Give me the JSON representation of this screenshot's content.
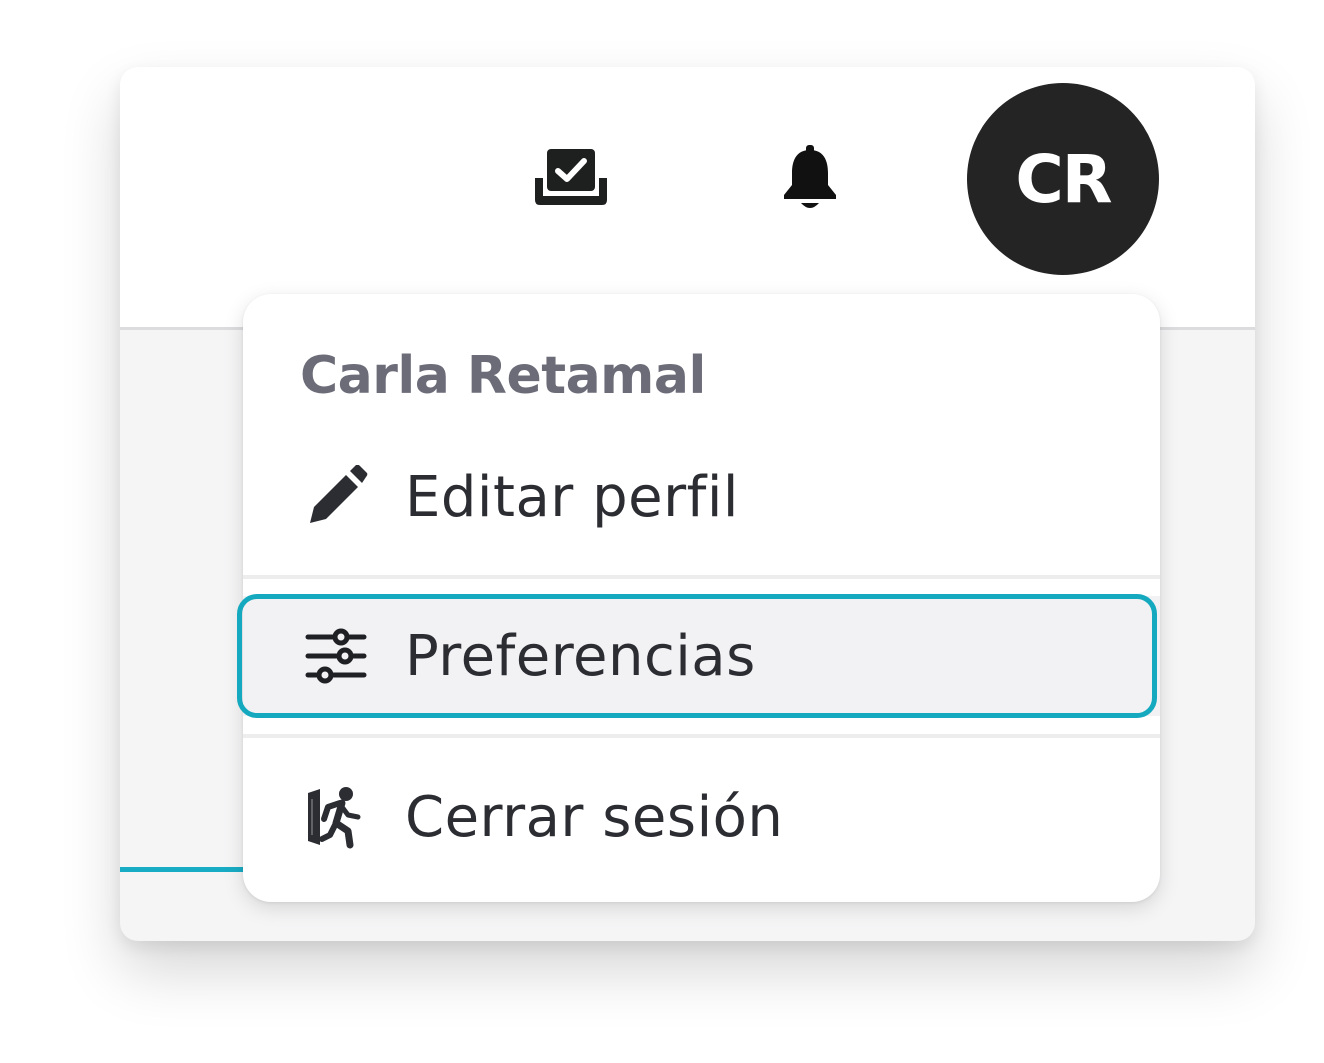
{
  "header": {
    "tasks_icon": "tasks-check-tray-icon",
    "notifications_icon": "bell-icon",
    "avatar_initials": "CR",
    "avatar_color": "#232423"
  },
  "user_menu": {
    "user_name": "Carla Retamal",
    "items": [
      {
        "label": "Editar perfil",
        "icon": "pencil-icon"
      },
      {
        "label": "Preferencias",
        "icon": "sliders-icon",
        "focused": true
      },
      {
        "label": "Cerrar sesión",
        "icon": "logout-runner-icon"
      }
    ]
  },
  "colors": {
    "accent": "#14a9bf",
    "user_name": "#6b6c78",
    "item_text": "#2c2d33",
    "focused_bg": "#f2f2f4"
  }
}
